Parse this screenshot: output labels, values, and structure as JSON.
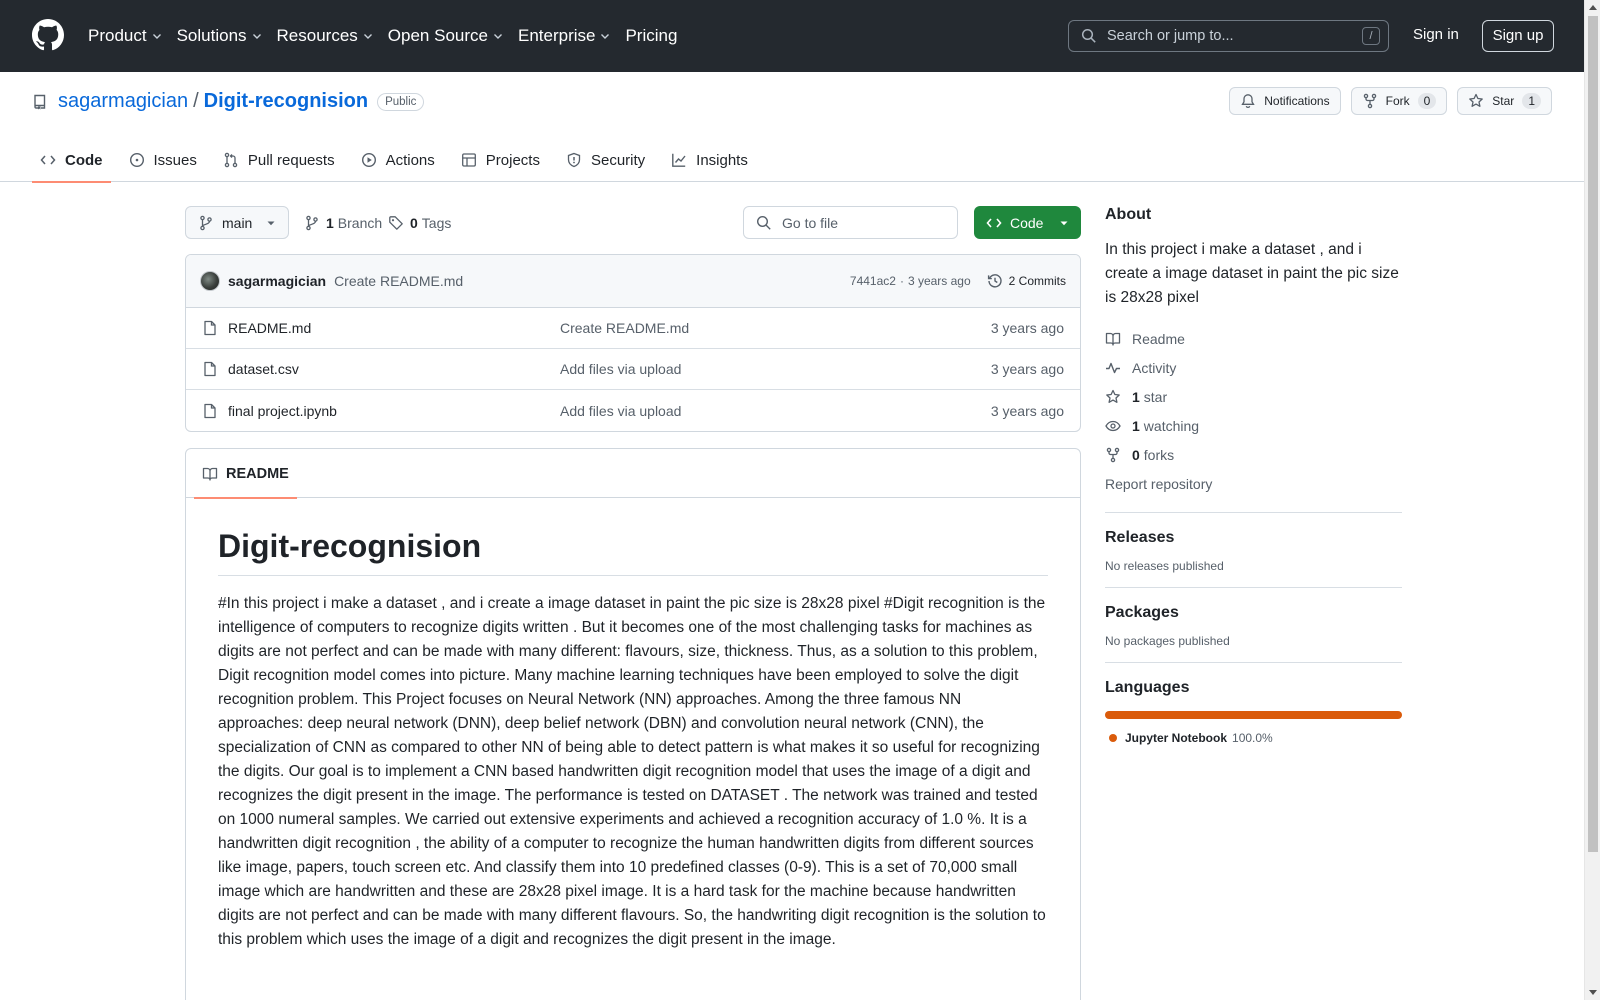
{
  "header": {
    "nav": [
      {
        "label": "Product",
        "dropdown": true
      },
      {
        "label": "Solutions",
        "dropdown": true
      },
      {
        "label": "Resources",
        "dropdown": true
      },
      {
        "label": "Open Source",
        "dropdown": true
      },
      {
        "label": "Enterprise",
        "dropdown": true
      },
      {
        "label": "Pricing",
        "dropdown": false
      }
    ],
    "search_placeholder": "Search or jump to...",
    "search_shortcut": "/",
    "sign_in": "Sign in",
    "sign_up": "Sign up"
  },
  "repo": {
    "owner": "sagarmagician",
    "separator": "/",
    "name": "Digit-recognision",
    "visibility": "Public",
    "actions": {
      "notifications": "Notifications",
      "fork": "Fork",
      "fork_count": "0",
      "star": "Star",
      "star_count": "1"
    },
    "tabs": [
      "Code",
      "Issues",
      "Pull requests",
      "Actions",
      "Projects",
      "Security",
      "Insights"
    ],
    "active_tab": "Code"
  },
  "toolbar": {
    "branch": "main",
    "branch_count": "1",
    "branch_label": "Branch",
    "tag_count": "0",
    "tag_label": "Tags",
    "goto_placeholder": "Go to file",
    "code_button": "Code"
  },
  "latest_commit": {
    "author": "sagarmagician",
    "message": "Create README.md",
    "hash": "7441ac2",
    "dot": "·",
    "age": "3 years ago",
    "commits_label": "2 Commits"
  },
  "files": [
    {
      "name": "README.md",
      "commit": "Create README.md",
      "age": "3 years ago"
    },
    {
      "name": "dataset.csv",
      "commit": "Add files via upload",
      "age": "3 years ago"
    },
    {
      "name": "final project.ipynb",
      "commit": "Add files via upload",
      "age": "3 years ago"
    }
  ],
  "readme": {
    "tab": "README",
    "title": "Digit-recognision",
    "body": "#In this project i make a dataset , and i create a image dataset in paint the pic size is 28x28 pixel #Digit recognition is the intelligence of computers to recognize digits written . But it becomes one of the most challenging tasks for machines as digits are not perfect and can be made with many different: flavours, size, thickness. Thus, as a solution to this problem, Digit recognition model comes into picture. Many machine learning techniques have been employed to solve the digit recognition problem. This Project focuses on Neural Network (NN) approaches. Among the three famous NN approaches: deep neural network (DNN), deep belief network (DBN) and convolution neural network (CNN), the specialization of CNN as compared to other NN of being able to detect pattern is what makes it so useful for recognizing the digits. Our goal is to implement a CNN based handwritten digit recognition model that uses the image of a digit and recognizes the digit present in the image. The performance is tested on DATASET . The network was trained and tested on 1000 numeral samples. We carried out extensive experiments and achieved a recognition accuracy of 1.0 %. It is a handwritten digit recognition , the ability of a computer to recognize the human handwritten digits from different sources like image, papers, touch screen etc. And classify them into 10 predefined classes (0-9). This is a set of 70,000 small image which are handwritten and these are 28x28 pixel image. It is a hard task for the machine because handwritten digits are not perfect and can be made with many different flavours. So, the handwriting digit recognition is the solution to this problem which uses the image of a digit and recognizes the digit present in the image."
  },
  "sidebar": {
    "about_title": "About",
    "about_desc": "In this project i make a dataset , and i create a image dataset in paint the pic size is 28x28 pixel",
    "readme": "Readme",
    "activity": "Activity",
    "stars_count": "1",
    "stars_label": "star",
    "watching_count": "1",
    "watching_label": "watching",
    "forks_count": "0",
    "forks_label": "forks",
    "report": "Report repository",
    "releases_title": "Releases",
    "releases_note": "No releases published",
    "packages_title": "Packages",
    "packages_note": "No packages published",
    "languages_title": "Languages",
    "languages": [
      {
        "name": "Jupyter Notebook",
        "percent": "100.0%",
        "fraction": 1.0,
        "color": "#DA5B0B"
      }
    ]
  },
  "colors": {
    "header_bg": "#24292F",
    "link": "#0969DA",
    "code_button": "#1F883D",
    "tab_underline": "#FD8C73"
  }
}
